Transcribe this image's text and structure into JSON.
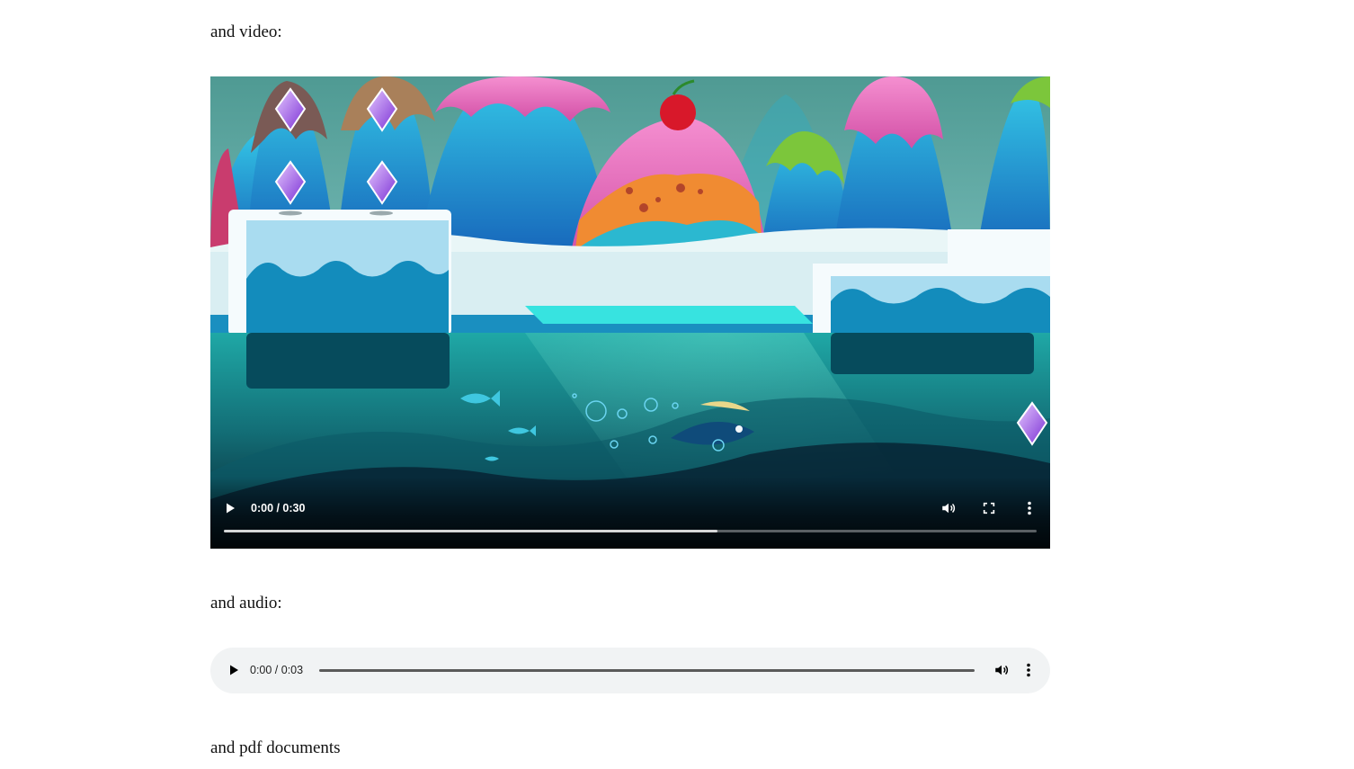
{
  "paragraphs": {
    "video_label": "and video:",
    "audio_label": "and audio:",
    "pdf_label": "and pdf documents"
  },
  "video_player": {
    "time": "0:00 / 0:30",
    "buffered_fraction": 0.607,
    "icons": [
      "play-icon",
      "volume-icon",
      "fullscreen-icon",
      "more-options-icon"
    ]
  },
  "audio_player": {
    "time": "0:00 / 0:03",
    "icons": [
      "play-icon",
      "volume-icon",
      "more-options-icon"
    ]
  },
  "colors": {
    "page_background": "#ffffff",
    "audio_background": "#f1f3f4",
    "video_controls_text": "#ffffff"
  }
}
